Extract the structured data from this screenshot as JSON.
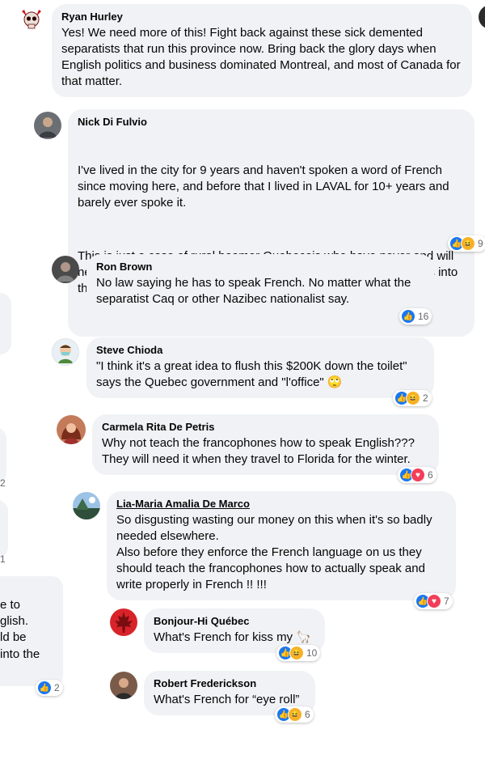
{
  "comments": [
    {
      "name": "Ryan Hurley",
      "text": [
        "Yes! We need more of this! Fight back against these sick demented separatists that run this province now. Bring back the glory days when English politics and business dominated Montreal, and most of Canada for that matter."
      ]
    },
    {
      "name": "Nick Di Fulvio",
      "text": [
        "I've lived in the city for 9 years and haven't spoken a word of French since moving here, and before that I lived in LAVAL for 10+ years and barely ever spoke it.",
        "This is just a case of rural boomer Quebecois who have never and will never visit Montreal clutching their pearls and deluding themselves into thinking the French language is a main business language."
      ],
      "reactions": "9"
    },
    {
      "name": "Ron Brown",
      "text": [
        "No law saying he has to speak French. No matter what the separatist Caq or other Nazibec nationalist say."
      ],
      "reactions": "16"
    },
    {
      "name": "Steve Chioda",
      "text": [
        "\"I think it's a great idea to flush this $200K down the toilet\" says the Quebec government and \"l'office\" 🙄"
      ],
      "reactions": "2"
    },
    {
      "name": "Carmela Rita De Petris",
      "text": [
        "Why not teach the francophones how to speak English??? They will need it when they travel to Florida for the winter."
      ],
      "reactions": "6"
    },
    {
      "name": "Lia-Maria Amalia De Marco",
      "text": [
        "So disgusting wasting our money on this when it's so badly needed elsewhere.\nAlso before they enforce the French language on us they should teach the francophones how to actually speak and write properly in French !! !!!"
      ],
      "reactions": "7"
    },
    {
      "name": "Bonjour-Hi Québec",
      "text": [
        "What's French for kiss my 🦙"
      ],
      "reactions": "10"
    },
    {
      "name": "Robert Frederickson",
      "text": [
        "What's French for “eye roll”"
      ],
      "reactions": "6"
    }
  ],
  "left_fragments": {
    "lines": [
      "e to",
      "glish.",
      "ld be",
      "into the"
    ],
    "reaction_count": "2",
    "small_marks": [
      "2",
      "1"
    ]
  },
  "icons": {
    "like": "like-icon",
    "haha": "haha-icon",
    "love": "love-icon"
  },
  "colors": {
    "bubble": "#f0f2f5",
    "like": "#1877f2",
    "love": "#f33e58",
    "haha": "#f7b125",
    "secondary_text": "#65676b"
  }
}
